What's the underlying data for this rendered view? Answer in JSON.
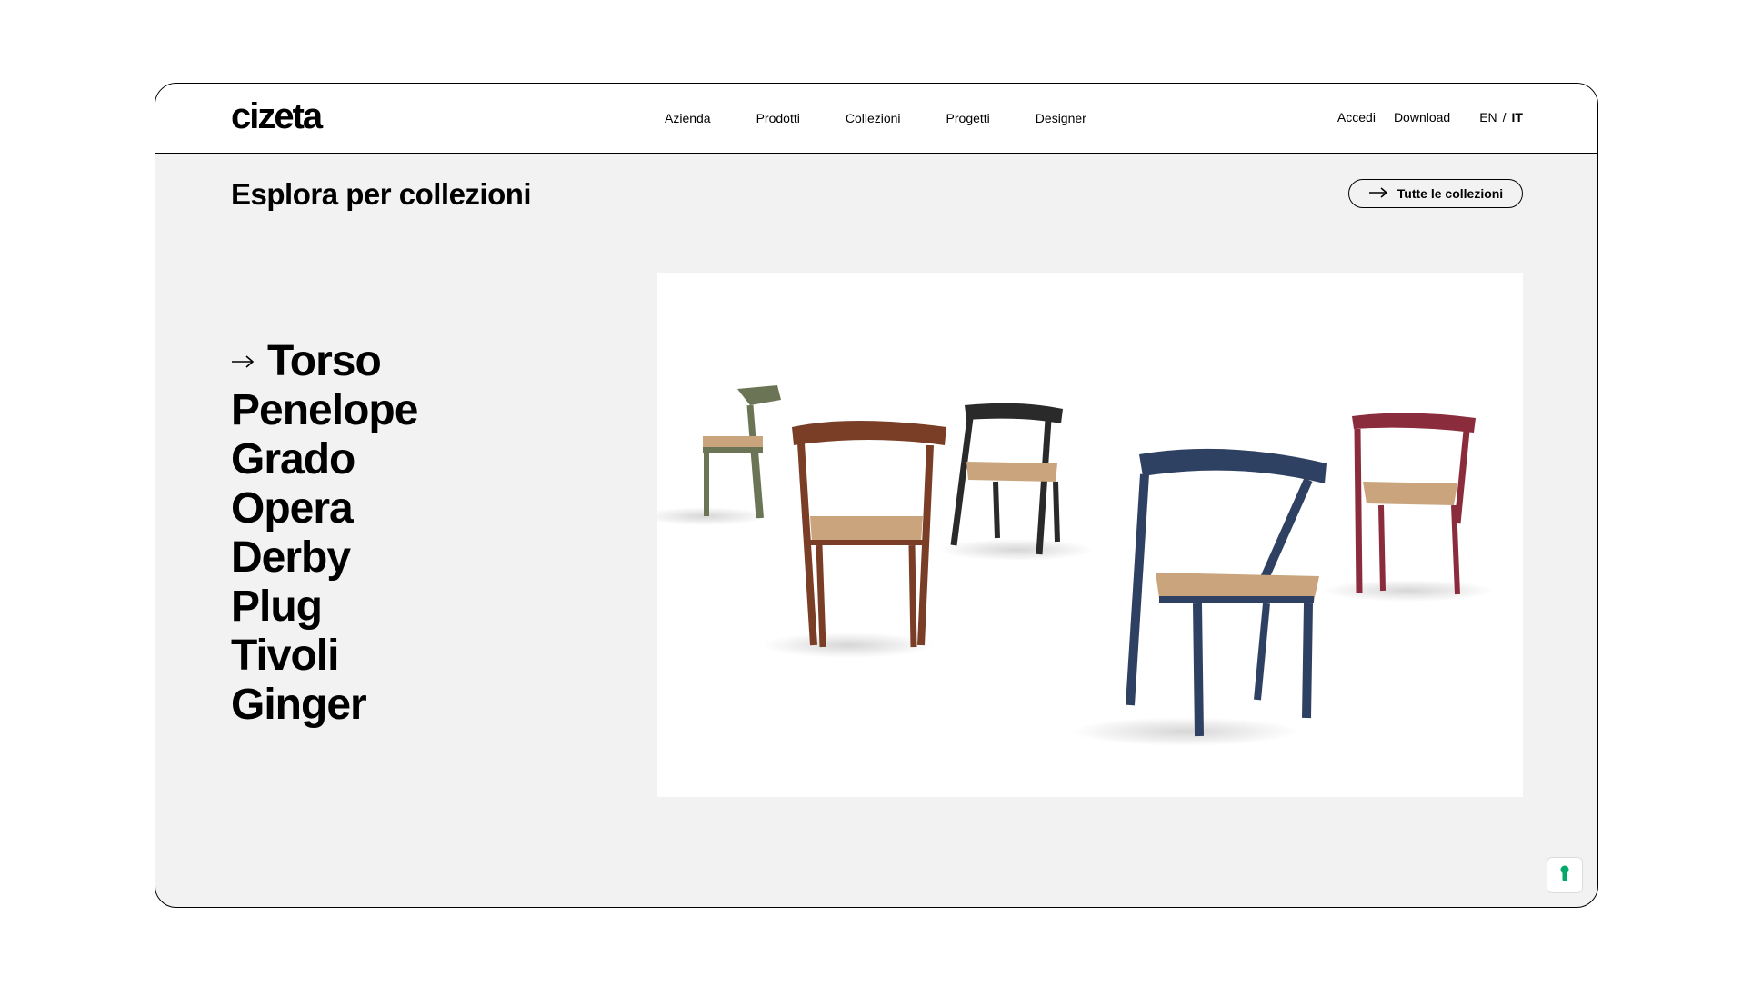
{
  "brand": {
    "logo_text": "cizeta"
  },
  "nav": {
    "items": [
      {
        "label": "Azienda"
      },
      {
        "label": "Prodotti"
      },
      {
        "label": "Collezioni"
      },
      {
        "label": "Progetti"
      },
      {
        "label": "Designer"
      }
    ],
    "right": {
      "login": "Accedi",
      "download": "Download",
      "lang_en": "EN",
      "lang_sep": "/",
      "lang_it": "IT"
    }
  },
  "section": {
    "title": "Esplora per collezioni",
    "all_button": "Tutte le collezioni"
  },
  "collections": [
    {
      "name": "Torso",
      "active": true
    },
    {
      "name": "Penelope"
    },
    {
      "name": "Grado"
    },
    {
      "name": "Opera"
    },
    {
      "name": "Derby"
    },
    {
      "name": "Plug"
    },
    {
      "name": "Tivoli"
    },
    {
      "name": "Ginger"
    }
  ],
  "icons": {
    "arrow": "arrow-right-icon",
    "cookie": "keyhole-icon"
  },
  "colors": {
    "background": "#f2f2f2",
    "border": "#000000",
    "cookie_accent": "#00a86b",
    "chair_green": "#6b7556",
    "chair_brown": "#7a3e26",
    "chair_black": "#2a2a2a",
    "chair_blue": "#2f4163",
    "chair_red": "#8a2c3b",
    "seat_rope": "#c9a47c"
  }
}
